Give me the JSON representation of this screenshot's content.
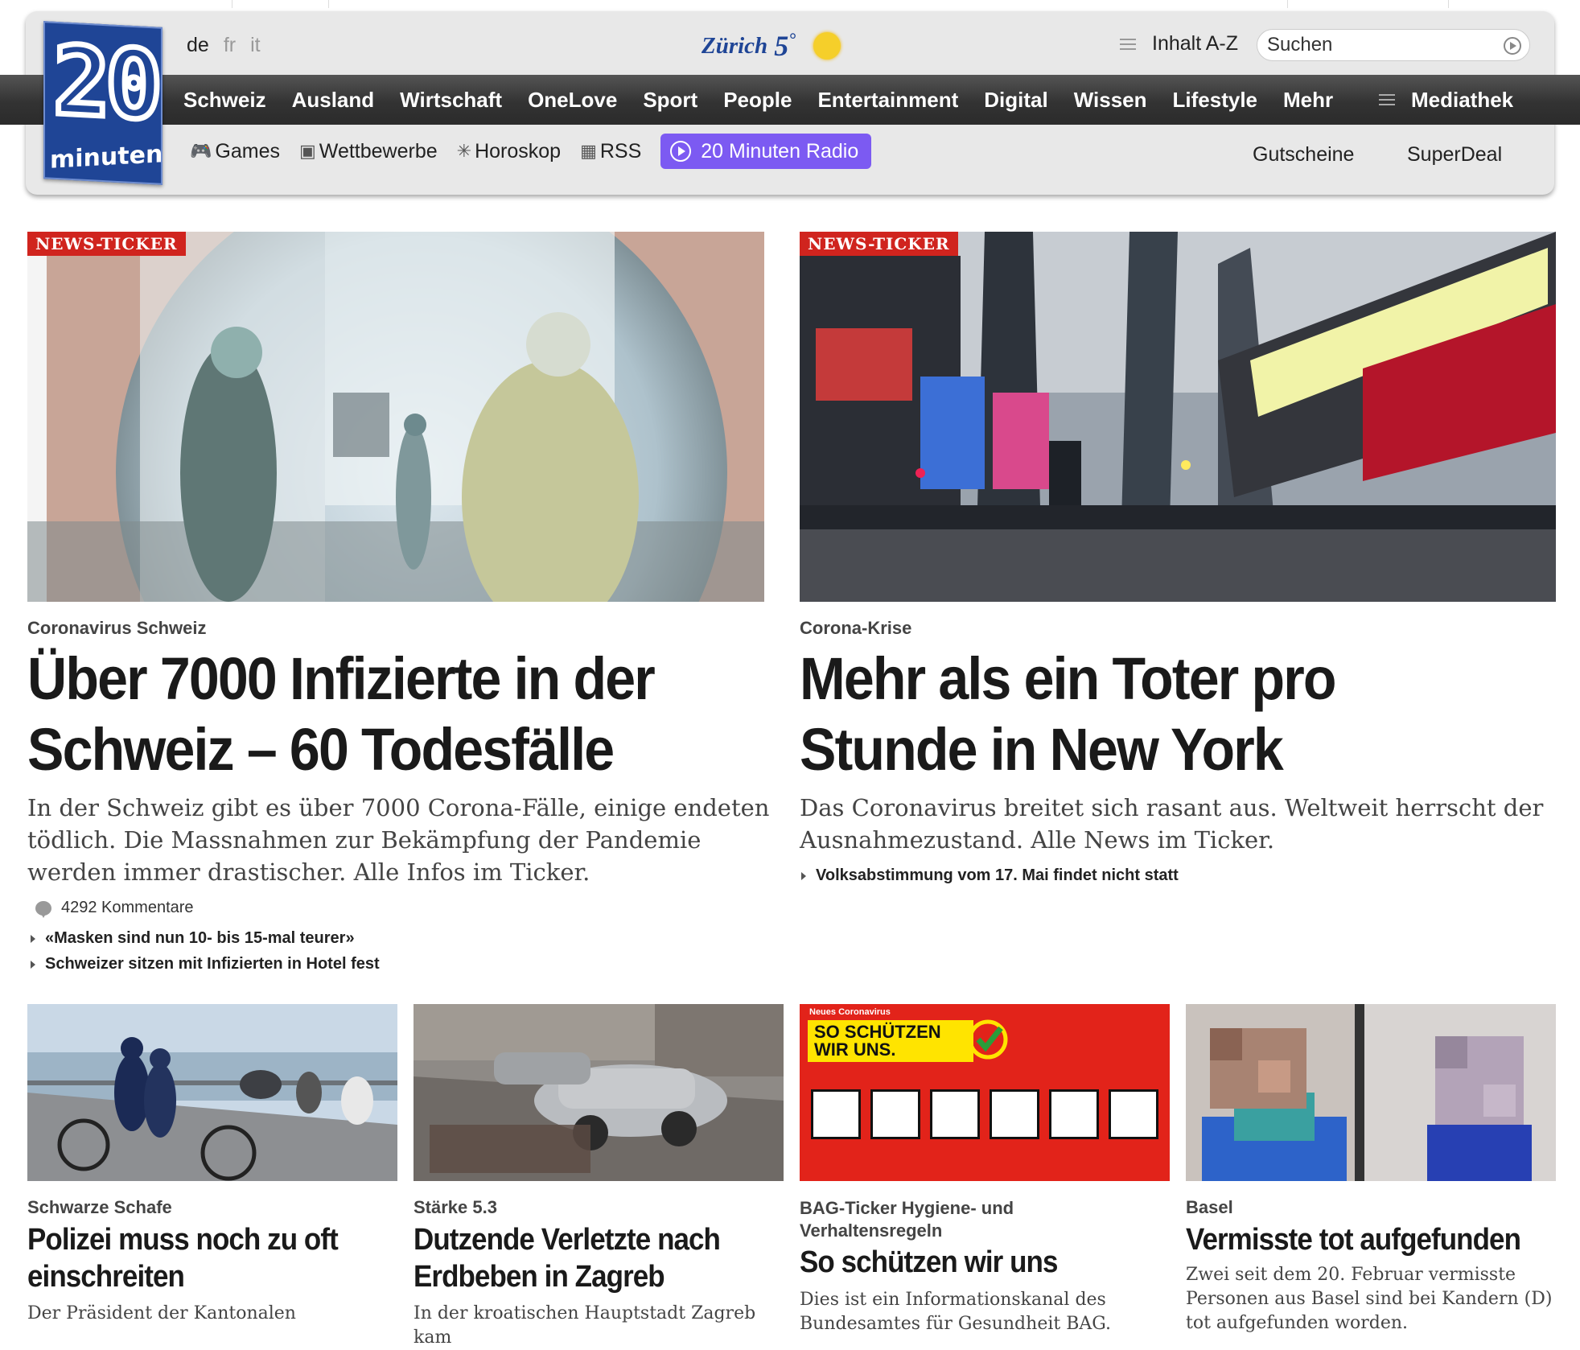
{
  "header": {
    "logo": {
      "number": "20",
      "word": "minuten"
    },
    "languages": [
      {
        "code": "de",
        "active": true
      },
      {
        "code": "fr",
        "active": false
      },
      {
        "code": "it",
        "active": false
      }
    ],
    "weather": {
      "city": "Zürich",
      "temp": "5",
      "unit": "°",
      "icon": "sun-icon"
    },
    "index_link": "Inhalt A-Z",
    "search": {
      "placeholder": "Suchen"
    },
    "nav": [
      "Schweiz",
      "Ausland",
      "Wirtschaft",
      "OneLove",
      "Sport",
      "People",
      "Entertainment",
      "Digital",
      "Wissen",
      "Lifestyle",
      "Mehr"
    ],
    "mediathek": "Mediathek",
    "subnav": [
      {
        "label": "Games",
        "icon": "gamepad-icon"
      },
      {
        "label": "Wettbewerbe",
        "icon": "gift-icon"
      },
      {
        "label": "Horoskop",
        "icon": "star-icon"
      },
      {
        "label": "RSS",
        "icon": "rss-icon"
      }
    ],
    "radio": "20 Minuten Radio",
    "right_links": [
      "Gutscheine",
      "SuperDeal"
    ],
    "accent": "#1f4596",
    "radio_color": "#7c5af2"
  },
  "featured": [
    {
      "badge": "NEWS-TICKER",
      "kicker": "Coronavirus Schweiz",
      "headline": "Über 7000 Infizierte in der Schweiz – 60 Todesfälle",
      "lead": "In der Schweiz gibt es über 7000 Corona-Fälle, einige endeten tödlich. Die Massnahmen zur Bekämpfung der Pandemie werden immer drastischer. Alle Infos im Ticker.",
      "comments": "4292 Kommentare",
      "related": [
        "«Masken sind nun 10- bis 15-mal teurer»",
        "Schweizer sitzen mit Infizierten in Hotel fest"
      ]
    },
    {
      "badge": "NEWS-TICKER",
      "kicker": "Corona-Krise",
      "headline": "Mehr als ein Toter pro Stunde in New York",
      "lead": "Das Coronavirus breitet sich rasant aus. Weltweit herrscht der Ausnahmezustand. Alle News im Ticker.",
      "related": [
        "Volksabstimmung vom 17. Mai findet nicht statt"
      ]
    }
  ],
  "cards": [
    {
      "kicker": "Schwarze Schafe",
      "headline": "Polizei muss noch zu oft einschreiten",
      "lead": "Der Präsident der Kantonalen"
    },
    {
      "kicker": "Stärke 5.3",
      "headline": "Dutzende Verletzte nach Erdbeben in Zagreb",
      "lead": "In der kroatischen Hauptstadt Zagreb kam"
    },
    {
      "kicker": "BAG-Ticker Hygiene- und Verhaltensregeln",
      "headline": "So schützen wir uns",
      "lead": "Dies ist ein Informationskanal des Bundesamtes für Gesundheit BAG.",
      "graphic": {
        "small": "Neues Coronavirus",
        "title_1": "SO SCHÜTZEN",
        "title_2": "WIR UNS."
      }
    },
    {
      "kicker": "Basel",
      "headline": "Vermisste tot aufgefunden",
      "lead": "Zwei seit dem 20. Februar vermisste Personen aus Basel sind bei Kandern (D) tot aufgefunden worden."
    }
  ]
}
